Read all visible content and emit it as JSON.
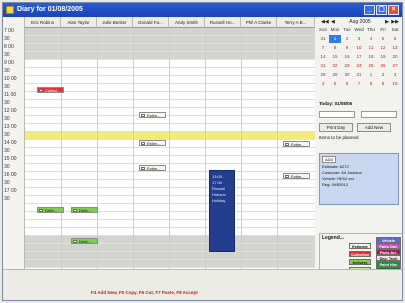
{
  "window": {
    "title": "Diary for 01/08/2005"
  },
  "columns": [
    "Eric Robins",
    "Alan Taylor",
    "Julie Becker",
    "Donald Fa...",
    "Andy Smith",
    "Russell Ho...",
    "Phil A Clarke",
    "Terry A B..."
  ],
  "times": [
    "7 00",
    "30",
    "8 00",
    "30",
    "9 00",
    "30",
    "10 00",
    "30",
    "11 00",
    "30",
    "12 00",
    "30",
    "13 00",
    "30",
    "14 00",
    "30",
    "15 00",
    "30",
    "16 00",
    "30",
    "17 00",
    "30"
  ],
  "appointments": {
    "red": "Collect...",
    "white1": "Estim...",
    "white2": "Estim...",
    "white3": "Estim...",
    "white4": "Estim...",
    "white5": "Estim...",
    "green1": "Deliv...",
    "green2": "Deliv...",
    "green3": "Deliv..."
  },
  "blue_block": {
    "line1": "13:00 - 17:30",
    "line2": "Russell",
    "line3": "Hobson",
    "line4": "Holiday"
  },
  "calendar": {
    "month": "Aug",
    "year": "2005",
    "days_of_week": [
      "Sun",
      "Mon",
      "Tue",
      "Wed",
      "Thu",
      "Fri",
      "Sat"
    ],
    "weeks": [
      [
        "31",
        "1",
        "2",
        "3",
        "4",
        "5",
        "6"
      ],
      [
        "7",
        "8",
        "9",
        "10",
        "11",
        "12",
        "13"
      ],
      [
        "14",
        "15",
        "16",
        "17",
        "18",
        "19",
        "20"
      ],
      [
        "21",
        "22",
        "23",
        "24",
        "25",
        "26",
        "27"
      ],
      [
        "28",
        "29",
        "30",
        "31",
        "1",
        "2",
        "3"
      ],
      [
        "4",
        "5",
        "6",
        "7",
        "8",
        "9",
        "10"
      ]
    ],
    "today": "Today: 01/08/05"
  },
  "panel": {
    "print_day": "Print Day",
    "add_new": "Add New",
    "items_label": "Items to be planned",
    "card_chip": "ADD",
    "card_lines": [
      "Estimate: 8272",
      "Customer: Mr Jackson",
      "Vehicle: HE52 xxx",
      "Reg: JHB3912"
    ]
  },
  "legend": {
    "title": "Legend...",
    "left": [
      "Estimate",
      "Collection",
      "Delivery",
      "Planned"
    ],
    "right": [
      "Vehicle",
      "Parts Ord.",
      "Parts Arr.",
      "Dep. Tech",
      "Paint Hire",
      "Paint Rec.",
      "Dep. Arr."
    ],
    "bottom": "Current Date and Time"
  },
  "colors": {
    "estimate": "#f7f7f5",
    "collection": "#e0303a",
    "delivery": "#7fce52",
    "planned": "#cfe7b6",
    "title_bar": "#2a5bd6",
    "highlight": "#f2ea7b",
    "holiday_block": "#243d8f"
  },
  "status": {
    "shortcuts": "F4 Add New, F5 Copy, F6 Cut, F7 Paste, F8 Accept"
  }
}
